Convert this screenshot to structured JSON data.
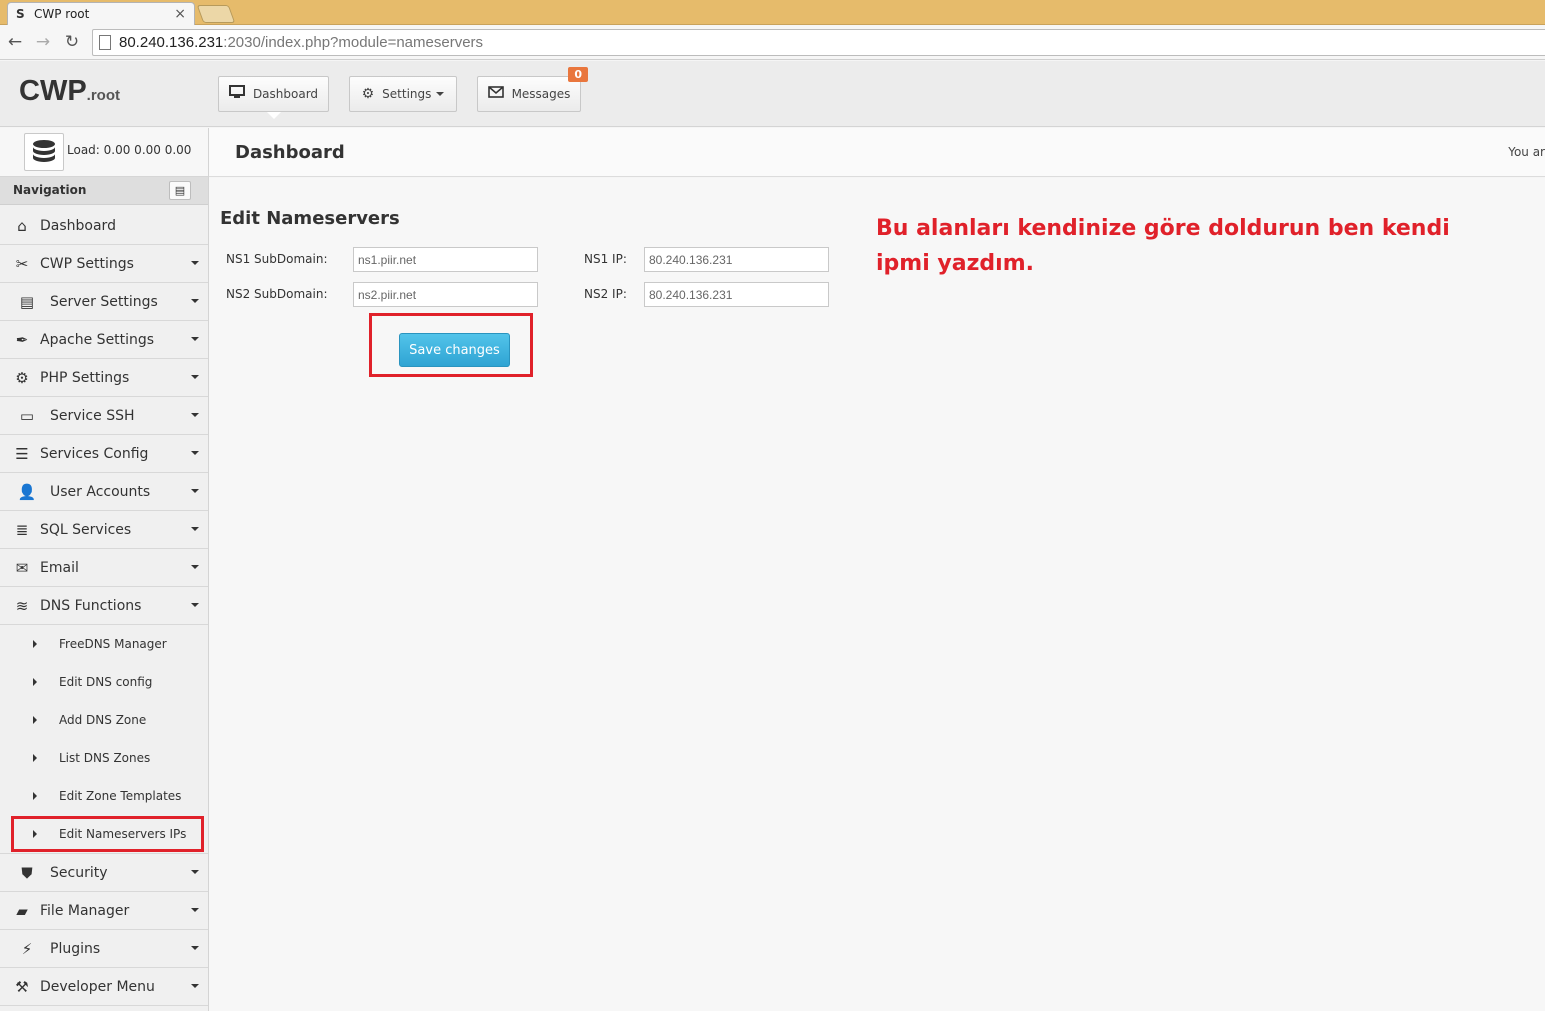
{
  "browser": {
    "tab_title": "CWP root",
    "tab_favicon": "S",
    "url_host": "80.240.136.231",
    "url_rest": ":2030/index.php?module=nameservers"
  },
  "header": {
    "logo_main": "CWP",
    "logo_sub": ".root",
    "buttons": {
      "dashboard": "Dashboard",
      "settings": "Settings",
      "messages": "Messages",
      "messages_count": "0"
    }
  },
  "sidebar": {
    "load": "Load: 0.00  0.00  0.00",
    "nav_title": "Navigation",
    "items": [
      {
        "label": "Dashboard",
        "icon": "home-icon"
      },
      {
        "label": "CWP Settings",
        "icon": "tools-icon"
      },
      {
        "label": "Server Settings",
        "icon": "server-icon"
      },
      {
        "label": "Apache Settings",
        "icon": "feather-icon"
      },
      {
        "label": "PHP Settings",
        "icon": "gear-icon"
      },
      {
        "label": "Service SSH",
        "icon": "monitor-icon"
      },
      {
        "label": "Services Config",
        "icon": "list-icon"
      },
      {
        "label": "User Accounts",
        "icon": "user-icon"
      },
      {
        "label": "SQL Services",
        "icon": "database-icon"
      },
      {
        "label": "Email",
        "icon": "envelope-icon"
      },
      {
        "label": "DNS Functions",
        "icon": "layers-icon"
      }
    ],
    "dns_sub": [
      {
        "label": "FreeDNS Manager"
      },
      {
        "label": "Edit DNS config"
      },
      {
        "label": "Add DNS Zone"
      },
      {
        "label": "List DNS Zones"
      },
      {
        "label": "Edit Zone Templates"
      },
      {
        "label": "Edit Nameservers IPs"
      }
    ],
    "items_after": [
      {
        "label": "Security",
        "icon": "shield-icon"
      },
      {
        "label": "File Manager",
        "icon": "folder-icon"
      },
      {
        "label": "Plugins",
        "icon": "plug-icon"
      },
      {
        "label": "Developer Menu",
        "icon": "hammer-icon"
      }
    ]
  },
  "main": {
    "page_title": "Dashboard",
    "page_head_right": "You ar",
    "section_title": "Edit Nameservers",
    "fields": {
      "ns1_sub_label": "NS1 SubDomain:",
      "ns1_sub_value": "ns1.piir.net",
      "ns2_sub_label": "NS2 SubDomain:",
      "ns2_sub_value": "ns2.piir.net",
      "ns1_ip_label": "NS1 IP:",
      "ns1_ip_value": "80.240.136.231",
      "ns2_ip_label": "NS2 IP:",
      "ns2_ip_value": "80.240.136.231"
    },
    "save_label": "Save changes",
    "annotation": "Bu alanları kendinize göre doldurun ben kendi ipmi yazdım."
  },
  "colors": {
    "annotation_red": "#e0212a",
    "save_button_blue": "#3bb3e0",
    "badge_orange": "#e9763d"
  }
}
